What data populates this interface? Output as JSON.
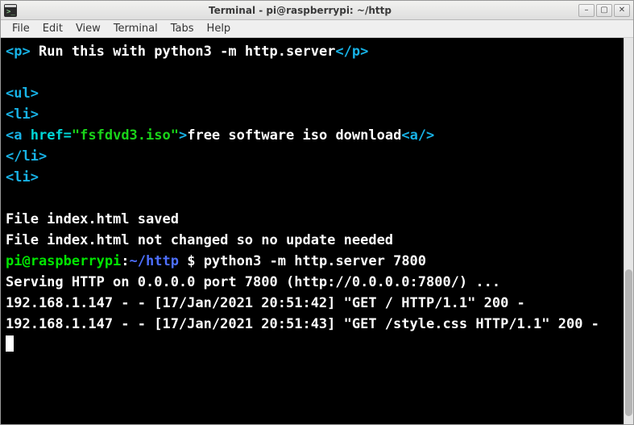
{
  "window": {
    "title": "Terminal - pi@raspberrypi: ~/http"
  },
  "menu": {
    "file": "File",
    "edit": "Edit",
    "view": "View",
    "terminal": "Terminal",
    "tabs": "Tabs",
    "help": "Help"
  },
  "html_source": {
    "p_tag_open": "<p>",
    "p_text": " Run this with python3 -m http.server",
    "p_tag_close": "</p>",
    "ul_open": "<ul>",
    "li_open": "<li>",
    "a_open": "<a ",
    "a_href_attr": "href=",
    "a_href_val": "\"fsfdvd3.iso\"",
    "a_close_bracket": ">",
    "a_text": "free software iso download",
    "a_close": "<a/>",
    "li_close": "</li>",
    "li_open2": "<li>"
  },
  "shell": {
    "saved_line": "File index.html saved",
    "nochange_line": "File index.html not changed so no update needed",
    "prompt_user": "pi@raspberrypi",
    "prompt_sep1": ":",
    "prompt_path": "~/http",
    "prompt_dollar": " $ ",
    "command": "python3 -m http.server 7800",
    "serve_line": "Serving HTTP on 0.0.0.0 port 7800 (http://0.0.0.0:7800/) ...",
    "log1": "192.168.1.147 - - [17/Jan/2021 20:51:42] \"GET / HTTP/1.1\" 200 -",
    "log2": "192.168.1.147 - - [17/Jan/2021 20:51:43] \"GET /style.css HTTP/1.1\" 200 -"
  },
  "controls": {
    "minimize": "–",
    "maximize": "▢",
    "close": "✕"
  }
}
